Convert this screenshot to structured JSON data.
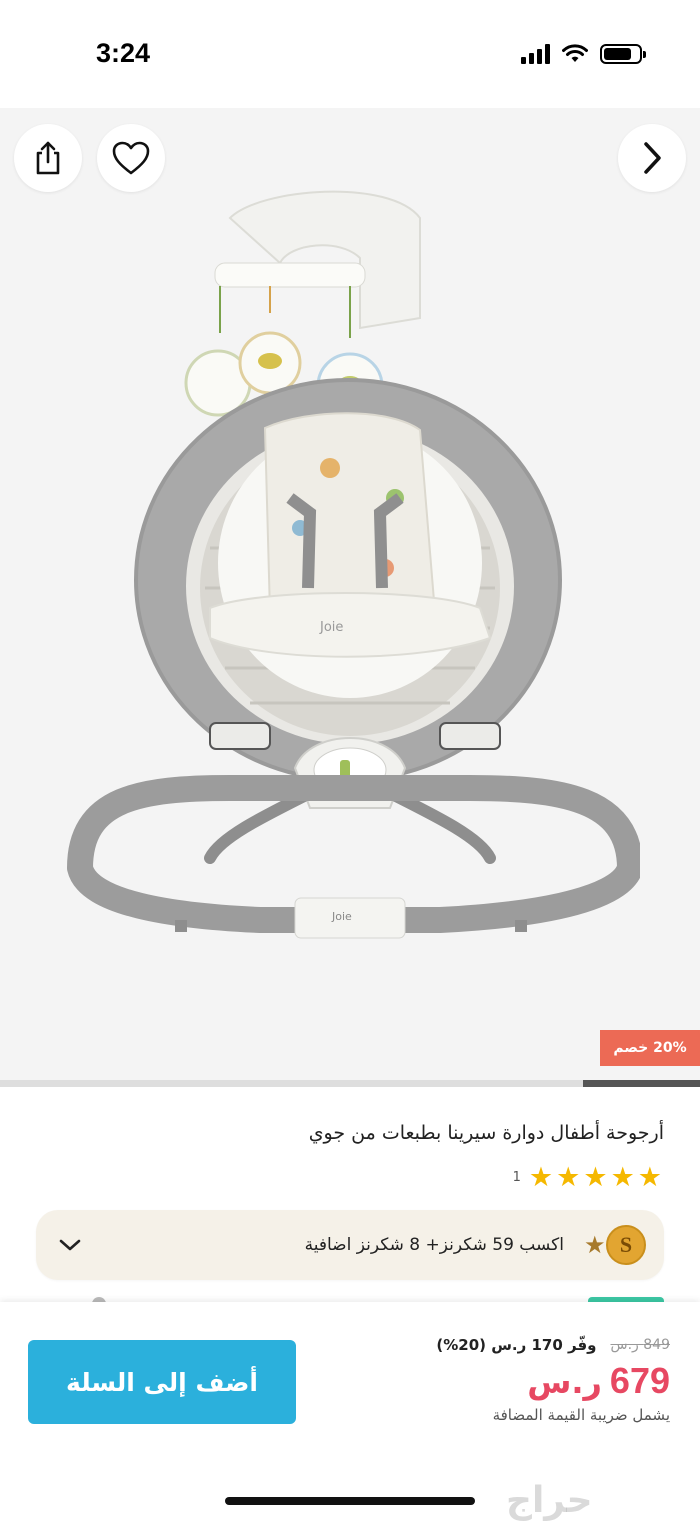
{
  "status_bar": {
    "time": "3:24"
  },
  "hero": {
    "discount_badge": "20% خصم"
  },
  "product": {
    "title": "أرجوحة أطفال دوارة سيرينا بطبعات من جوي",
    "rating_count": "1",
    "stars": 5,
    "brand_print": "Joie"
  },
  "rewards": {
    "coin_letter": "S",
    "text": "اكسب 59 شكرنز+  8 شكرنز اضافية"
  },
  "purchase": {
    "old_price": "849 ر.س",
    "save_text": "وفّر 170 ر.س (20%)",
    "price": "679",
    "currency": "ر.س",
    "vat_note": "يشمل ضريبة القيمة المضافة",
    "add_to_cart": "أضف إلى السلة"
  },
  "watermark": "حراج",
  "colors": {
    "accent_button": "#2bb0dc",
    "price": "#e74862",
    "badge": "#ec6a55",
    "star": "#f5b800"
  }
}
